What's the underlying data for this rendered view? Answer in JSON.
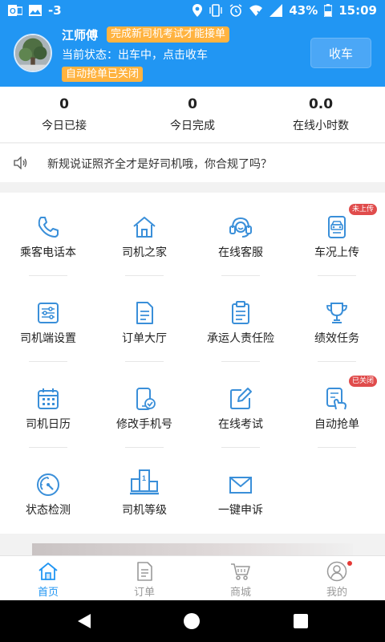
{
  "status_bar": {
    "notification_count": "-3",
    "battery": "43%",
    "time": "15:09",
    "icons": [
      "outlook-icon",
      "image-icon",
      "location-icon",
      "vibrate-icon",
      "alarm-icon",
      "wifi-off-icon",
      "signal-icon",
      "battery-icon"
    ]
  },
  "header": {
    "driver_name": "江师傅",
    "hint_badge": "完成新司机考试才能接单",
    "state_text": "当前状态：出车中，点击收车",
    "auto_badge": "自动抢单已关闭",
    "finish_button": "收车"
  },
  "stats": [
    {
      "value": "0",
      "label": "今日已接"
    },
    {
      "value": "0",
      "label": "今日完成"
    },
    {
      "value": "0.0",
      "label": "在线小时数"
    }
  ],
  "notice": {
    "text": "新规说证照齐全才是好司机哦，你合规了吗？"
  },
  "grid": [
    {
      "label": "乘客电话本",
      "icon": "phone-icon"
    },
    {
      "label": "司机之家",
      "icon": "home-icon"
    },
    {
      "label": "在线客服",
      "icon": "headset-icon"
    },
    {
      "label": "车况上传",
      "icon": "car-icon",
      "badge": "未上传"
    },
    {
      "label": "司机端设置",
      "icon": "sliders-icon"
    },
    {
      "label": "订单大厅",
      "icon": "document-icon"
    },
    {
      "label": "承运人责任险",
      "icon": "clipboard-icon"
    },
    {
      "label": "绩效任务",
      "icon": "trophy-icon"
    },
    {
      "label": "司机日历",
      "icon": "calendar-icon"
    },
    {
      "label": "修改手机号",
      "icon": "phone-check-icon"
    },
    {
      "label": "在线考试",
      "icon": "edit-icon"
    },
    {
      "label": "自动抢单",
      "icon": "tap-icon",
      "badge": "已关闭"
    },
    {
      "label": "状态检测",
      "icon": "gauge-icon"
    },
    {
      "label": "司机等级",
      "icon": "podium-icon"
    },
    {
      "label": "一键申诉",
      "icon": "mail-icon"
    }
  ],
  "tabs": [
    {
      "label": "首页",
      "icon": "home-icon",
      "active": true
    },
    {
      "label": "订单",
      "icon": "order-icon",
      "active": false
    },
    {
      "label": "商城",
      "icon": "cart-icon",
      "active": false
    },
    {
      "label": "我的",
      "icon": "user-icon",
      "active": false
    }
  ],
  "colors": {
    "primary": "#2196f3",
    "badge_orange": "#ffb340",
    "badge_red": "#e04c4c",
    "icon_blue": "#3a8fd9"
  }
}
